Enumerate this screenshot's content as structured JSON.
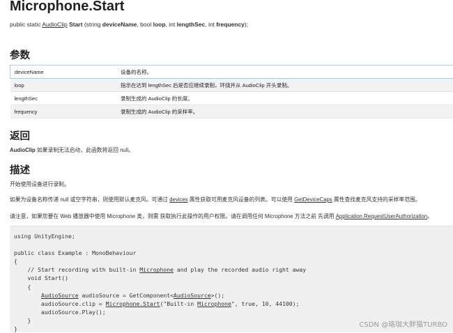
{
  "title": "Microphone.Start",
  "signature": {
    "prefix": "public static ",
    "return_type": "AudioClip",
    "method": "Start",
    "open": " (string ",
    "p1": "deviceName",
    "s1": ", bool ",
    "p2": "loop",
    "s2": ", int ",
    "p3": "lengthSec",
    "s3": ", int ",
    "p4": "frequency",
    "close": ");"
  },
  "sections": {
    "params": "参数",
    "returns": "返回",
    "description": "描述"
  },
  "parameters": [
    {
      "name": "deviceName",
      "desc": "设备的名称。"
    },
    {
      "name": "loop",
      "desc": "指示在达到 lengthSec 后是否应继续录制，环绕并从 AudioClip 开头录制。"
    },
    {
      "name": "lengthSec",
      "desc": "录制生成的 AudioClip 的长度。"
    },
    {
      "name": "frequency",
      "desc": "录制生成的 AudioClip 的采样率。"
    }
  ],
  "returns": {
    "type": "AudioClip",
    "text": " 如果录制无法启动，此函数将返回 null。"
  },
  "description": {
    "line1": "开始使用设备进行录制。",
    "line2_a": "如果为设备名称传递 null 或空字符串，则使用默认麦克风。可通过 ",
    "line2_link1": "devices",
    "line2_b": " 属性获取可用麦克风设备的列表。可以使用 ",
    "line2_link2": "GetDeviceCaps",
    "line2_c": " 属性查找麦克风支持的采样率范围。",
    "line3_a": "请注意，如果您要在 Web 播放器中使用 Microphone 类，则需 获取执行此操作的用户权限。请在调用任何 Microphone 方法之前 先调用 ",
    "line3_link": "Application.RequestUserAuthorization",
    "line3_b": "。"
  },
  "code": {
    "l1": "using UnityEngine;",
    "l2": "public class Example : MonoBehaviour",
    "l3": "{",
    "l4a": "    // Start recording with built-in ",
    "l4u": "Microphone",
    "l4b": " and play the recorded audio right away",
    "l5": "    void Start()",
    "l6": "    {",
    "l7_indent": "        ",
    "l7u1": "AudioSource",
    "l7a": " audioSource = GetComponent<",
    "l7u2": "AudioSource",
    "l7b": ">();",
    "l8a": "        audioSource.clip = ",
    "l8u1": "Microphone.Start",
    "l8b": "(\"Built-in ",
    "l8u2": "Microphone",
    "l8c": "\", true, 10, 44100);",
    "l9": "        audioSource.Play();",
    "l10": "    }",
    "l11": "}"
  },
  "watermark": "CSDN @珞珈大胖猫TURBO"
}
